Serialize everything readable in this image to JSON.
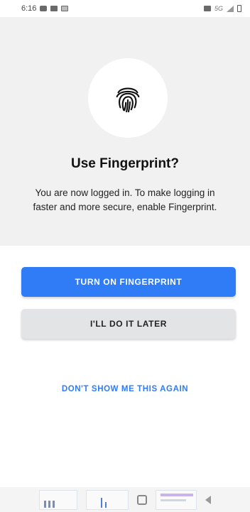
{
  "status_bar": {
    "time": "6:16",
    "network_label": "5G"
  },
  "prompt": {
    "icon": "fingerprint-icon",
    "title": "Use Fingerprint?",
    "body": "You are now logged in. To make logging in faster and more secure, enable Fingerprint."
  },
  "actions": {
    "primary_label": "TURN ON FINGERPRINT",
    "secondary_label": "I'LL DO IT LATER",
    "link_label": "DON'T SHOW ME THIS AGAIN"
  },
  "colors": {
    "accent": "#2f7cf6",
    "hero_background": "#f1f1f1",
    "secondary_button": "#e3e4e6"
  }
}
